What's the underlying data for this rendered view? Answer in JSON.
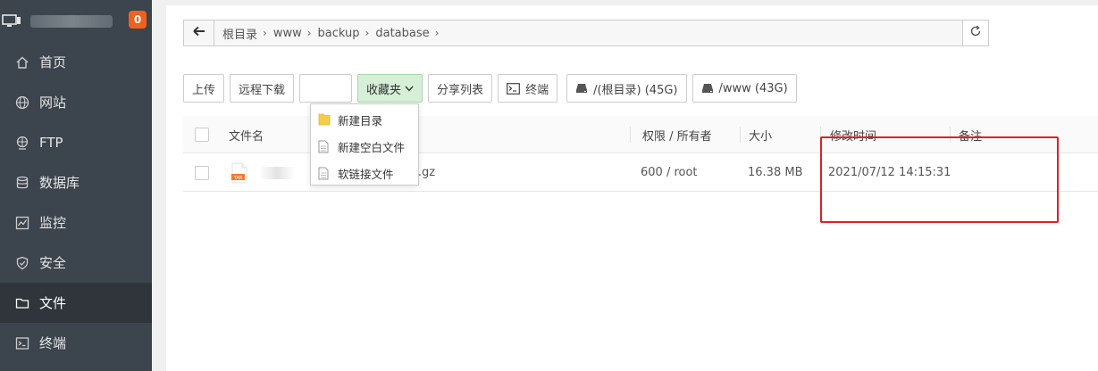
{
  "sidebar": {
    "badge": "0",
    "items": [
      {
        "label": "首页",
        "icon": "home-icon"
      },
      {
        "label": "网站",
        "icon": "globe-icon"
      },
      {
        "label": "FTP",
        "icon": "ftp-globe-icon"
      },
      {
        "label": "数据库",
        "icon": "database-icon"
      },
      {
        "label": "监控",
        "icon": "monitor-chart-icon"
      },
      {
        "label": "安全",
        "icon": "shield-icon"
      },
      {
        "label": "文件",
        "icon": "folder-icon"
      },
      {
        "label": "终端",
        "icon": "terminal-icon"
      }
    ],
    "active_index": 6
  },
  "breadcrumb": {
    "items": [
      "根目录",
      "www",
      "backup",
      "database"
    ]
  },
  "toolbar": {
    "upload": "上传",
    "remote_download": "远程下载",
    "favorites": "收藏夹",
    "share_list": "分享列表",
    "terminal": "终端",
    "disk_root": "/(根目录) (45G)",
    "disk_www": "/www (43G)"
  },
  "new_menu": {
    "items": [
      {
        "label": "新建目录",
        "icon": "folder-icon"
      },
      {
        "label": "新建空白文件",
        "icon": "file-icon"
      },
      {
        "label": "软链接文件",
        "icon": "file-icon"
      }
    ]
  },
  "table": {
    "headers": {
      "name": "文件名",
      "perm": "权限 / 所有者",
      "size": "大小",
      "mtime": "修改时间",
      "remark": "备注"
    },
    "rows": [
      {
        "name": "5601.sql.gz",
        "perm": "600 / root",
        "size": "16.38 MB",
        "mtime": "2021/07/12 14:15:31",
        "remark": ""
      }
    ]
  },
  "colors": {
    "sidebar_bg": "#3c444d",
    "sidebar_active": "#2f353b",
    "badge": "#f0611d",
    "favorites_btn": "#d6efd7",
    "annotation": "#e02020",
    "archive_icon": "#f07a2b"
  }
}
